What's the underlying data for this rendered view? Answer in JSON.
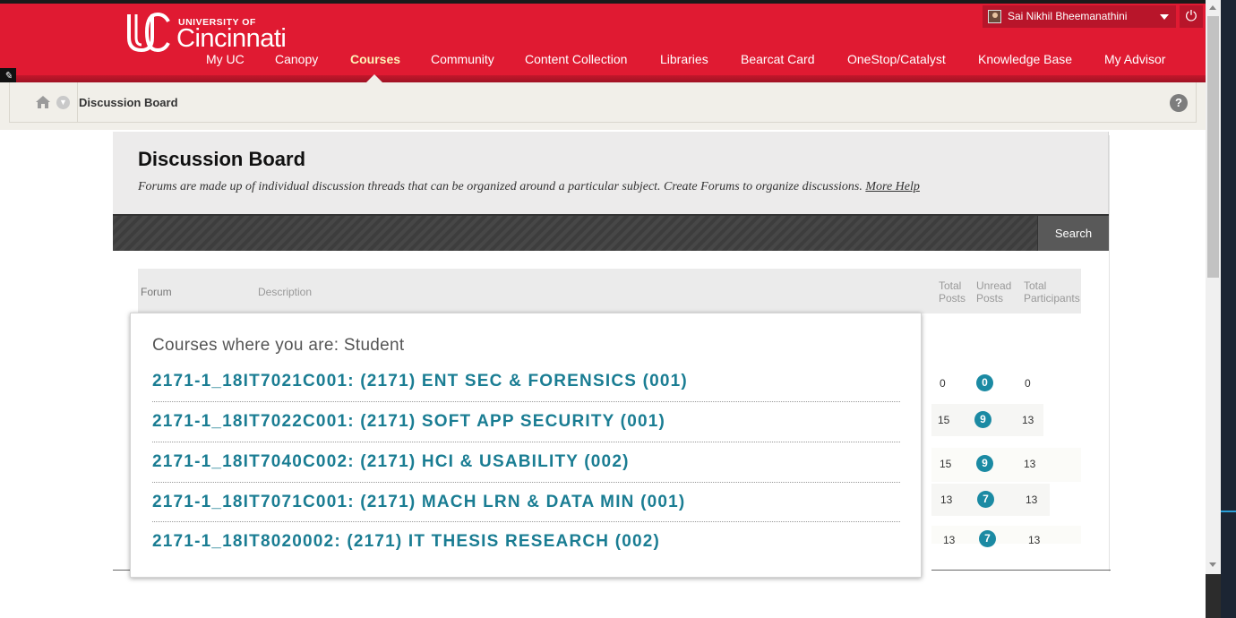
{
  "header": {
    "logo_small": "UNIVERSITY OF",
    "logo_big": "Cincinnati",
    "user_name": "Sai Nikhil Bheemanathini",
    "nav": [
      {
        "label": "My UC",
        "active": false
      },
      {
        "label": "Canopy",
        "active": false
      },
      {
        "label": "Courses",
        "active": true
      },
      {
        "label": "Community",
        "active": false
      },
      {
        "label": "Content Collection",
        "active": false
      },
      {
        "label": "Libraries",
        "active": false
      },
      {
        "label": "Bearcat Card",
        "active": false
      },
      {
        "label": "OneStop/Catalyst",
        "active": false
      },
      {
        "label": "Knowledge Base",
        "active": false
      },
      {
        "label": "My Advisor",
        "active": false
      }
    ],
    "colors": {
      "brand": "#e01a32",
      "active_nav": "#fdf3b8"
    }
  },
  "breadcrumb": {
    "current": "Discussion Board"
  },
  "page": {
    "title": "Discussion Board",
    "description": "Forums are made up of individual discussion threads that can be organized around a particular subject. Create Forums to organize discussions.",
    "more_help": "More Help",
    "search_label": "Search"
  },
  "table": {
    "col_forum": "Forum",
    "col_description": "Description",
    "col_total_posts_1": "Total",
    "col_total_posts_2": "Posts",
    "col_unread_1": "Unread",
    "col_unread_2": "Posts",
    "col_participants_1": "Total",
    "col_participants_2": "Participants",
    "rows": [
      {
        "total": "0",
        "unread": "0",
        "participants": "0"
      },
      {
        "total": "15",
        "unread": "9",
        "participants": "13"
      },
      {
        "total": "15",
        "unread": "9",
        "participants": "13"
      },
      {
        "total": "13",
        "unread": "7",
        "participants": "13"
      },
      {
        "total": "13",
        "unread": "7",
        "participants": "13"
      }
    ]
  },
  "course_menu": {
    "heading": "Courses where you are: Student",
    "courses": [
      "2171-1_18IT7021C001: (2171) ENT SEC & FORENSICS (001)",
      "2171-1_18IT7022C001: (2171) SOFT APP SECURITY (001)",
      "2171-1_18IT7040C002: (2171) HCI & USABILITY (002)",
      "2171-1_18IT7071C001: (2171) MACH LRN & DATA MIN (001)",
      "2171-1_18IT8020002: (2171) IT THESIS RESEARCH (002)"
    ],
    "link_color": "#1a7d93"
  },
  "icons": [
    "pencil-icon",
    "home-icon",
    "chevron-down-icon",
    "help-icon",
    "power-icon",
    "user-avatar",
    "caret-down-icon"
  ]
}
